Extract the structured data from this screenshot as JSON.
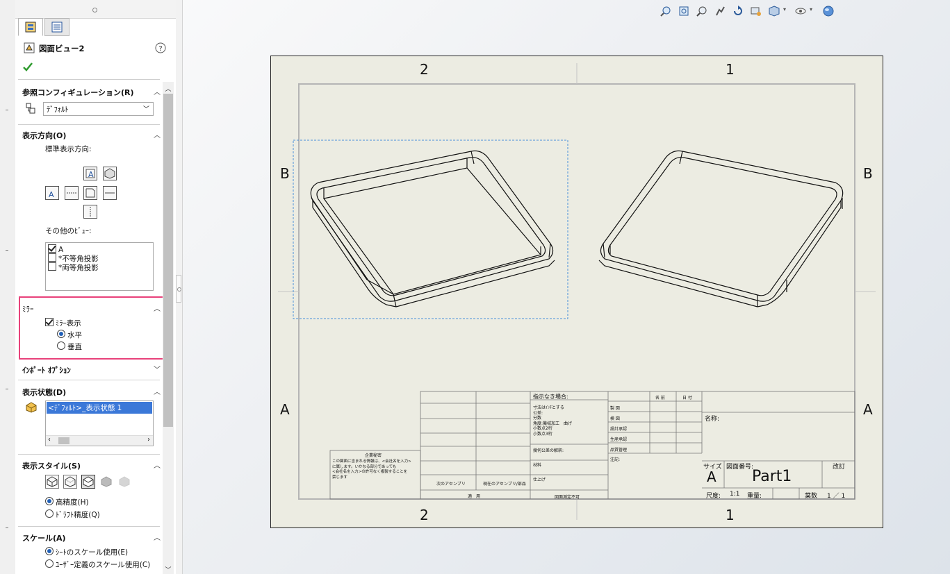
{
  "property_manager": {
    "title": "図面ビュー2",
    "ref_config": {
      "header": "参照コンフィギュレーション(R)",
      "value": "ﾃﾞﾌｫﾙﾄ"
    },
    "orientation": {
      "header": "表示方向(O)",
      "standard_label": "標準表示方向:",
      "other_label": "その他のﾋﾞｭｰ:",
      "other_items": [
        "A",
        "*不等角投影",
        "*両等角投影"
      ]
    },
    "mirror": {
      "header": "ﾐﾗｰ",
      "show_label": "ﾐﾗｰ表示",
      "horizontal_label": "水平",
      "vertical_label": "垂直"
    },
    "import_options": {
      "header": "ｲﾝﾎﾟｰﾄ ｵﾌﾟｼｮﾝ"
    },
    "display_state": {
      "header": "表示状態(D)",
      "item": "<ﾃﾞﾌｫﾙﾄ>_表示状態 1"
    },
    "display_style": {
      "header": "表示スタイル(S)",
      "high_quality": "高精度(H)",
      "draft_quality": "ﾄﾞﾗﾌﾄ精度(Q)"
    },
    "scale": {
      "header": "スケール(A)",
      "use_sheet": "ｼｰﾄのスケール使用(E)",
      "user_defined": "ﾕｰｻﾞｰ定義のスケール使用(C)"
    }
  },
  "sheet": {
    "zones_top": [
      "2",
      "1"
    ],
    "zones_bottom": [
      "2",
      "1"
    ],
    "zones_left": [
      "B",
      "A"
    ],
    "zones_right": [
      "B",
      "A"
    ]
  },
  "title_block": {
    "unless_noted": "指示なき場合:",
    "spec_lines": [
      "寸法はｲﾝﾁとする",
      "公差:",
      "分数",
      "角度:機械加工　曲げ",
      "小数点2桁",
      "小数点3桁"
    ],
    "tolerance_interp": "幾何公差の解釈:",
    "material": "材料",
    "finish": "仕上げ",
    "next_assy": "次のアセンブリ",
    "used_on": "現在のアセンブリ/部品",
    "application": "適　用",
    "no_scale": "図面測定不可",
    "col_name": "名 前",
    "col_date": "日 付",
    "drawn": "製 図",
    "checked": "検 図",
    "eng_appr": "設計承認",
    "mfg_appr": "生産承認",
    "qa": "品質管理",
    "comments": "注記:",
    "name_label": "名称:",
    "size_label": "サイズ",
    "size_value": "A",
    "dwg_no_label": "図面番号:",
    "dwg_no_value": "Part1",
    "rev_label": "改訂",
    "scale_label": "尺度:",
    "scale_value": "1:1",
    "weight_label": "重量:",
    "sheet_label": "葉数",
    "sheet_value": "1 ／ 1",
    "confidential_title": "企業秘密",
    "confidential_lines": [
      "この図面に含まれる情報は、<会社名を入力>",
      "に属します。いかなる部分であっても",
      "<会社名を入力>の許可なく複製することを",
      "禁じます"
    ]
  }
}
